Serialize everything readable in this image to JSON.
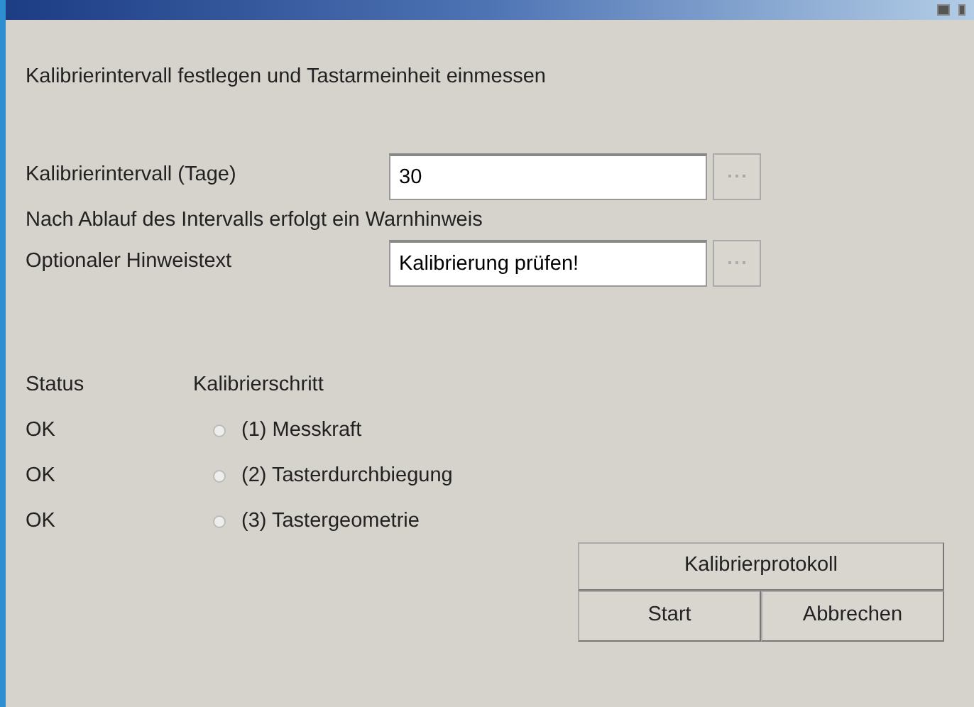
{
  "heading": "Kalibrierintervall festlegen und Tastarmeinheit einmessen",
  "fields": [
    {
      "label": "Kalibrierintervall (Tage)",
      "value": "30"
    },
    {
      "note": "Nach Ablauf des Intervalls erfolgt ein Warnhinweis",
      "label": "Optionaler Hinweistext",
      "value": "Kalibrierung prüfen!"
    }
  ],
  "steps_table": {
    "columns": [
      "Status",
      "Kalibrierschritt"
    ],
    "rows": [
      {
        "status": "OK",
        "step": "(1)  Messkraft",
        "selected": false
      },
      {
        "status": "OK",
        "step": "(2)  Tasterdurchbiegung",
        "selected": false
      },
      {
        "status": "OK",
        "step": "(3)  Tastergeometrie",
        "selected": false
      }
    ]
  },
  "buttons": [
    {
      "label": "Kalibrierprotokoll"
    },
    {
      "label": "Start"
    },
    {
      "label": "Abbrechen"
    }
  ]
}
